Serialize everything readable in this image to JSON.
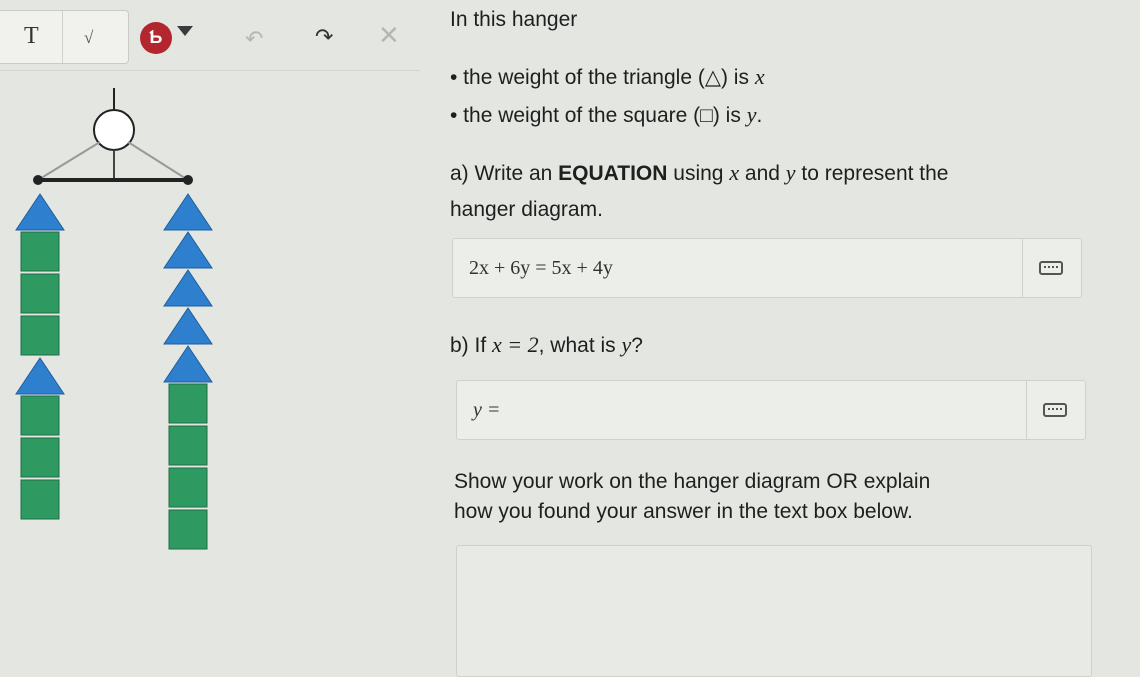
{
  "toolbar": {
    "text_tool": "T",
    "math_tool": "√",
    "pen_label": "Ƅ",
    "icons": [
      "text-tool-icon",
      "math-tool-icon",
      "pen-icon",
      "undo-icon",
      "redo-icon",
      "close-icon"
    ],
    "pen_color": "#b3262e"
  },
  "question": {
    "intro": "In this hanger",
    "bullet1_text": "• the weight of the triangle (△) is ",
    "bullet1_var": "x",
    "bullet2_text": "• the weight of the square (□) is ",
    "bullet2_var": "y",
    "bullet2_end": ".",
    "part_a_prefix": "a) Write an ",
    "part_a_bold": "EQUATION",
    "part_a_mid": " using ",
    "part_a_x": "x",
    "part_a_and": " and ",
    "part_a_y": "y",
    "part_a_suffix": " to represent the",
    "part_a_line2": "hanger diagram.",
    "part_b_prefix": "b) If ",
    "part_b_cond": "x = 2",
    "part_b_mid": ", what is ",
    "part_b_var": "y",
    "part_b_q": "?",
    "show_line1": "Show your work on the hanger diagram OR explain",
    "show_line2": "how you found your answer in the text box below."
  },
  "answers": {
    "equation_value": "2x + 6y  =  5x + 4y",
    "y_value": "y ="
  },
  "hanger": {
    "left_side": [
      "triangle",
      "square",
      "square",
      "square",
      "triangle",
      "square",
      "square",
      "square"
    ],
    "right_side": [
      "triangle",
      "triangle",
      "triangle",
      "triangle",
      "triangle",
      "square",
      "square",
      "square",
      "square"
    ],
    "colors": {
      "triangle": "#2f7fcf",
      "square": "#2e9a62"
    }
  }
}
